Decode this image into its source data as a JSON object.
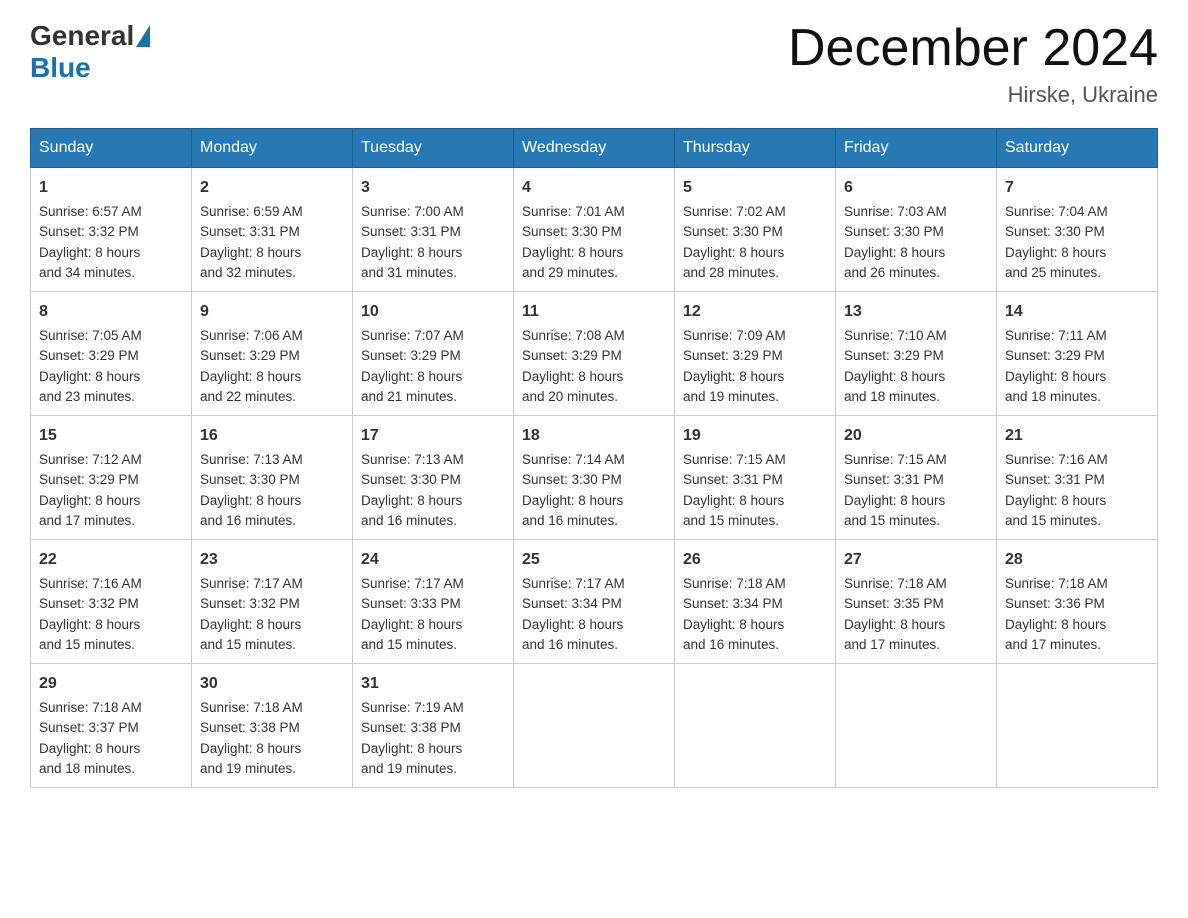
{
  "logo": {
    "general": "General",
    "blue": "Blue"
  },
  "title": "December 2024",
  "location": "Hirske, Ukraine",
  "days_header": [
    "Sunday",
    "Monday",
    "Tuesday",
    "Wednesday",
    "Thursday",
    "Friday",
    "Saturday"
  ],
  "weeks": [
    [
      {
        "day": "1",
        "sunrise": "Sunrise: 6:57 AM",
        "sunset": "Sunset: 3:32 PM",
        "daylight": "Daylight: 8 hours",
        "minutes": "and 34 minutes."
      },
      {
        "day": "2",
        "sunrise": "Sunrise: 6:59 AM",
        "sunset": "Sunset: 3:31 PM",
        "daylight": "Daylight: 8 hours",
        "minutes": "and 32 minutes."
      },
      {
        "day": "3",
        "sunrise": "Sunrise: 7:00 AM",
        "sunset": "Sunset: 3:31 PM",
        "daylight": "Daylight: 8 hours",
        "minutes": "and 31 minutes."
      },
      {
        "day": "4",
        "sunrise": "Sunrise: 7:01 AM",
        "sunset": "Sunset: 3:30 PM",
        "daylight": "Daylight: 8 hours",
        "minutes": "and 29 minutes."
      },
      {
        "day": "5",
        "sunrise": "Sunrise: 7:02 AM",
        "sunset": "Sunset: 3:30 PM",
        "daylight": "Daylight: 8 hours",
        "minutes": "and 28 minutes."
      },
      {
        "day": "6",
        "sunrise": "Sunrise: 7:03 AM",
        "sunset": "Sunset: 3:30 PM",
        "daylight": "Daylight: 8 hours",
        "minutes": "and 26 minutes."
      },
      {
        "day": "7",
        "sunrise": "Sunrise: 7:04 AM",
        "sunset": "Sunset: 3:30 PM",
        "daylight": "Daylight: 8 hours",
        "minutes": "and 25 minutes."
      }
    ],
    [
      {
        "day": "8",
        "sunrise": "Sunrise: 7:05 AM",
        "sunset": "Sunset: 3:29 PM",
        "daylight": "Daylight: 8 hours",
        "minutes": "and 23 minutes."
      },
      {
        "day": "9",
        "sunrise": "Sunrise: 7:06 AM",
        "sunset": "Sunset: 3:29 PM",
        "daylight": "Daylight: 8 hours",
        "minutes": "and 22 minutes."
      },
      {
        "day": "10",
        "sunrise": "Sunrise: 7:07 AM",
        "sunset": "Sunset: 3:29 PM",
        "daylight": "Daylight: 8 hours",
        "minutes": "and 21 minutes."
      },
      {
        "day": "11",
        "sunrise": "Sunrise: 7:08 AM",
        "sunset": "Sunset: 3:29 PM",
        "daylight": "Daylight: 8 hours",
        "minutes": "and 20 minutes."
      },
      {
        "day": "12",
        "sunrise": "Sunrise: 7:09 AM",
        "sunset": "Sunset: 3:29 PM",
        "daylight": "Daylight: 8 hours",
        "minutes": "and 19 minutes."
      },
      {
        "day": "13",
        "sunrise": "Sunrise: 7:10 AM",
        "sunset": "Sunset: 3:29 PM",
        "daylight": "Daylight: 8 hours",
        "minutes": "and 18 minutes."
      },
      {
        "day": "14",
        "sunrise": "Sunrise: 7:11 AM",
        "sunset": "Sunset: 3:29 PM",
        "daylight": "Daylight: 8 hours",
        "minutes": "and 18 minutes."
      }
    ],
    [
      {
        "day": "15",
        "sunrise": "Sunrise: 7:12 AM",
        "sunset": "Sunset: 3:29 PM",
        "daylight": "Daylight: 8 hours",
        "minutes": "and 17 minutes."
      },
      {
        "day": "16",
        "sunrise": "Sunrise: 7:13 AM",
        "sunset": "Sunset: 3:30 PM",
        "daylight": "Daylight: 8 hours",
        "minutes": "and 16 minutes."
      },
      {
        "day": "17",
        "sunrise": "Sunrise: 7:13 AM",
        "sunset": "Sunset: 3:30 PM",
        "daylight": "Daylight: 8 hours",
        "minutes": "and 16 minutes."
      },
      {
        "day": "18",
        "sunrise": "Sunrise: 7:14 AM",
        "sunset": "Sunset: 3:30 PM",
        "daylight": "Daylight: 8 hours",
        "minutes": "and 16 minutes."
      },
      {
        "day": "19",
        "sunrise": "Sunrise: 7:15 AM",
        "sunset": "Sunset: 3:31 PM",
        "daylight": "Daylight: 8 hours",
        "minutes": "and 15 minutes."
      },
      {
        "day": "20",
        "sunrise": "Sunrise: 7:15 AM",
        "sunset": "Sunset: 3:31 PM",
        "daylight": "Daylight: 8 hours",
        "minutes": "and 15 minutes."
      },
      {
        "day": "21",
        "sunrise": "Sunrise: 7:16 AM",
        "sunset": "Sunset: 3:31 PM",
        "daylight": "Daylight: 8 hours",
        "minutes": "and 15 minutes."
      }
    ],
    [
      {
        "day": "22",
        "sunrise": "Sunrise: 7:16 AM",
        "sunset": "Sunset: 3:32 PM",
        "daylight": "Daylight: 8 hours",
        "minutes": "and 15 minutes."
      },
      {
        "day": "23",
        "sunrise": "Sunrise: 7:17 AM",
        "sunset": "Sunset: 3:32 PM",
        "daylight": "Daylight: 8 hours",
        "minutes": "and 15 minutes."
      },
      {
        "day": "24",
        "sunrise": "Sunrise: 7:17 AM",
        "sunset": "Sunset: 3:33 PM",
        "daylight": "Daylight: 8 hours",
        "minutes": "and 15 minutes."
      },
      {
        "day": "25",
        "sunrise": "Sunrise: 7:17 AM",
        "sunset": "Sunset: 3:34 PM",
        "daylight": "Daylight: 8 hours",
        "minutes": "and 16 minutes."
      },
      {
        "day": "26",
        "sunrise": "Sunrise: 7:18 AM",
        "sunset": "Sunset: 3:34 PM",
        "daylight": "Daylight: 8 hours",
        "minutes": "and 16 minutes."
      },
      {
        "day": "27",
        "sunrise": "Sunrise: 7:18 AM",
        "sunset": "Sunset: 3:35 PM",
        "daylight": "Daylight: 8 hours",
        "minutes": "and 17 minutes."
      },
      {
        "day": "28",
        "sunrise": "Sunrise: 7:18 AM",
        "sunset": "Sunset: 3:36 PM",
        "daylight": "Daylight: 8 hours",
        "minutes": "and 17 minutes."
      }
    ],
    [
      {
        "day": "29",
        "sunrise": "Sunrise: 7:18 AM",
        "sunset": "Sunset: 3:37 PM",
        "daylight": "Daylight: 8 hours",
        "minutes": "and 18 minutes."
      },
      {
        "day": "30",
        "sunrise": "Sunrise: 7:18 AM",
        "sunset": "Sunset: 3:38 PM",
        "daylight": "Daylight: 8 hours",
        "minutes": "and 19 minutes."
      },
      {
        "day": "31",
        "sunrise": "Sunrise: 7:19 AM",
        "sunset": "Sunset: 3:38 PM",
        "daylight": "Daylight: 8 hours",
        "minutes": "and 19 minutes."
      },
      null,
      null,
      null,
      null
    ]
  ]
}
